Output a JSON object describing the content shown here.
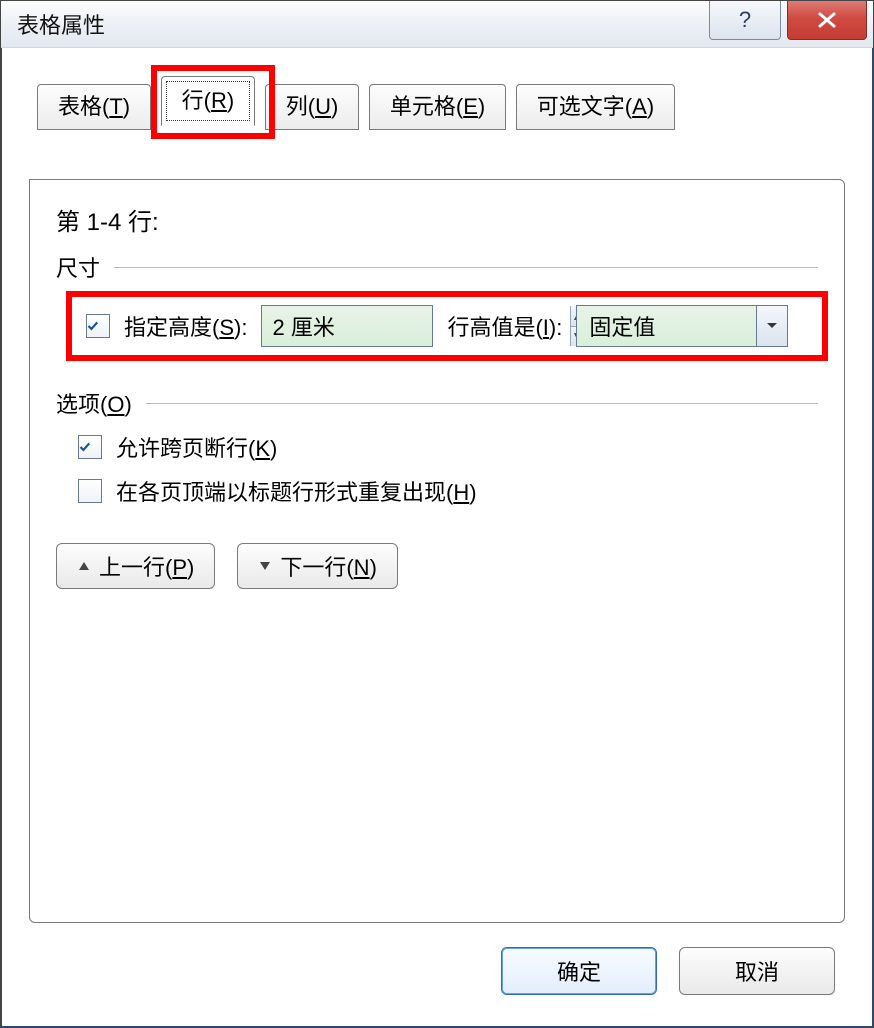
{
  "window": {
    "title": "表格属性"
  },
  "titlebar": {
    "help_label": "?",
    "close_label": "x"
  },
  "tabs": [
    {
      "label": "表格(T)"
    },
    {
      "label": "行(R)"
    },
    {
      "label": "列(U)"
    },
    {
      "label": "单元格(E)"
    },
    {
      "label": "可选文字(A)"
    }
  ],
  "row_info": "第 1-4 行:",
  "size": {
    "group_label": "尺寸",
    "specify_height_label": "指定高度(S):",
    "height_value": "2 厘米",
    "row_height_is_label": "行高值是(I):",
    "row_height_mode": "固定值"
  },
  "options": {
    "group_label": "选项(O)",
    "allow_break_label": "允许跨页断行(K)",
    "repeat_header_label": "在各页顶端以标题行形式重复出现(H)"
  },
  "nav": {
    "prev_label": "上一行(P)",
    "next_label": "下一行(N)"
  },
  "footer": {
    "ok_label": "确定",
    "cancel_label": "取消"
  }
}
